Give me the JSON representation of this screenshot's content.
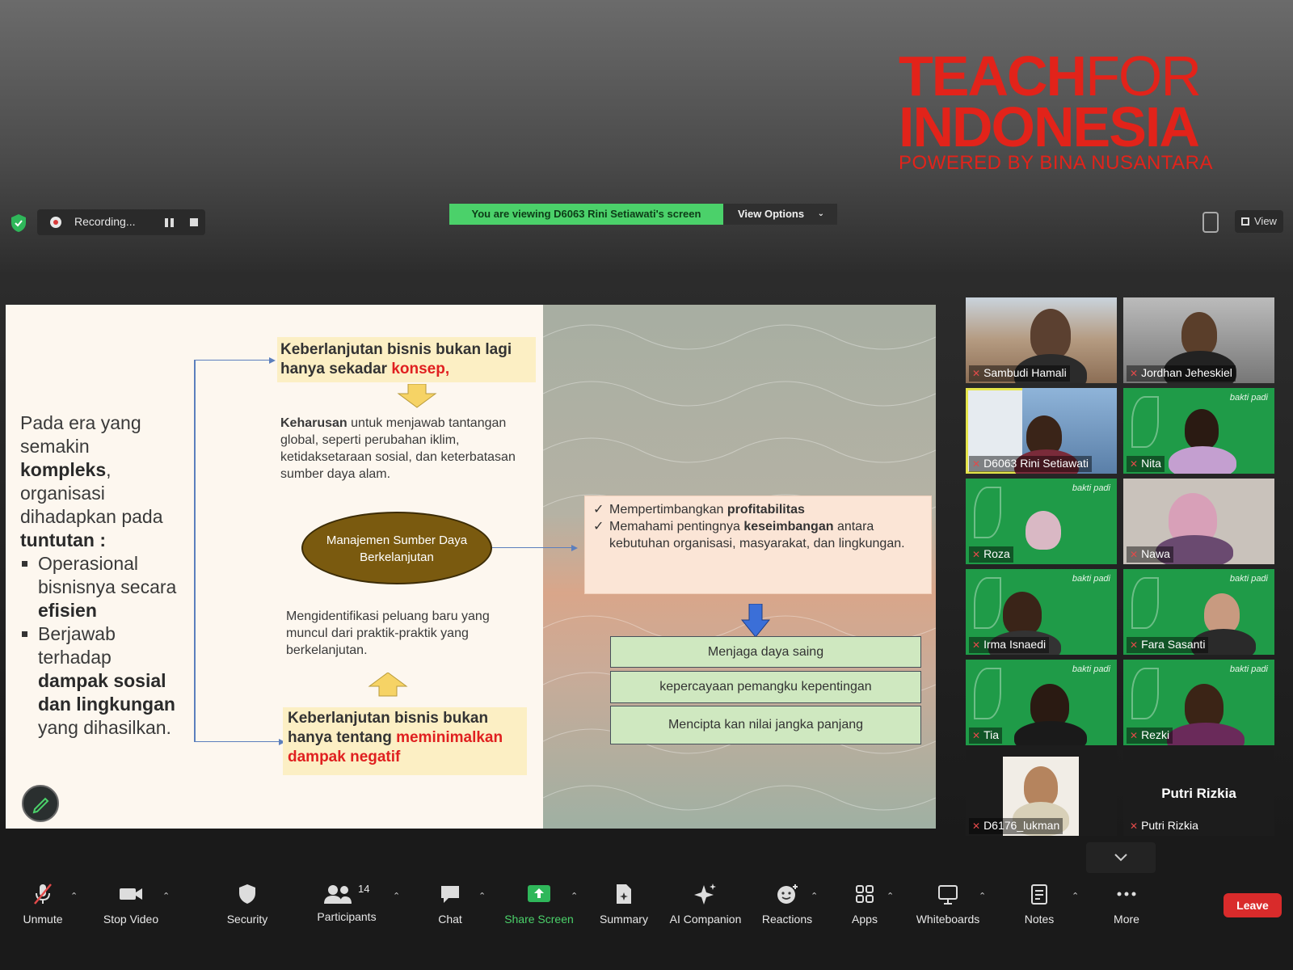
{
  "logo": {
    "line1_bold": "TEACH",
    "line1_thin": "FOR",
    "line2": "INDONESIA",
    "line3": "POWERED BY BINA NUSANTARA"
  },
  "topbar": {
    "recording_label": "Recording...",
    "viewing_banner": "You are viewing D6063 Rini Setiawati's screen",
    "view_options": "View Options",
    "view_button": "View"
  },
  "slide": {
    "left_intro": "Pada era yang semakin",
    "left_bold1": "kompleks",
    "left_mid": "organisasi dihadapkan pada",
    "left_bold2": "tuntutan :",
    "bullet1_pre": "Operasional bisnisnya secara",
    "bullet1_bold": "efisien",
    "bullet2_pre": "Berjawab terhadap",
    "bullet2_bold": "dampak sosial dan lingkungan",
    "bullet2_post": "yang dihasilkan.",
    "box1_text": "Keberlanjutan bisnis bukan lagi hanya sekadar",
    "box1_red": "konsep,",
    "keharusan_bold": "Keharusan",
    "keharusan_text": "untuk menjawab tantangan global, seperti perubahan iklim, ketidaksetaraan sosial, dan keterbatasan sumber daya alam.",
    "ellipse_text": "Manajemen Sumber Daya Berkelanjutan",
    "identify_text": "Mengidentifikasi peluang baru yang muncul dari praktik-praktik yang berkelanjutan.",
    "box2_text": "Keberlanjutan bisnis bukan hanya tentang",
    "box2_red": "meminimalkan dampak negatif",
    "check1_pre": "Mempertimbangkan",
    "check1_bold": "profitabilitas",
    "check2_pre": "Memahami pentingnya",
    "check2_bold": "keseimbangan",
    "check2_post": "antara kebutuhan organisasi, masyarakat, dan lingkungan.",
    "green1": "Menjaga daya saing",
    "green2": "kepercayaan pemangku kepentingan",
    "green3": "Mencipta kan nilai jangka panjang"
  },
  "participants": [
    {
      "name": "Sambudi Hamali"
    },
    {
      "name": "Jordhan Jeheskiel"
    },
    {
      "name": "D6063 Rini Setiawati"
    },
    {
      "name": "Nita"
    },
    {
      "name": "Roza"
    },
    {
      "name": "Nawa"
    },
    {
      "name": "Irma Isnaedi"
    },
    {
      "name": "Fara Sasanti"
    },
    {
      "name": "Tia"
    },
    {
      "name": "Rezki"
    },
    {
      "name": "D6176_lukman"
    },
    {
      "name": "Putri Rizkia",
      "display": "Putri Rizkia"
    }
  ],
  "tile_brand": "bakti padi",
  "toolbar": {
    "unmute": "Unmute",
    "stop_video": "Stop Video",
    "security": "Security",
    "participants": "Participants",
    "participants_count": "14",
    "chat": "Chat",
    "share_screen": "Share Screen",
    "summary": "Summary",
    "ai_companion": "AI Companion",
    "reactions": "Reactions",
    "apps": "Apps",
    "whiteboards": "Whiteboards",
    "notes": "Notes",
    "more": "More",
    "leave": "Leave"
  },
  "colors": {
    "brand_red": "#e2231a",
    "share_green": "#4bd16a",
    "leave_red": "#d92b2b"
  }
}
